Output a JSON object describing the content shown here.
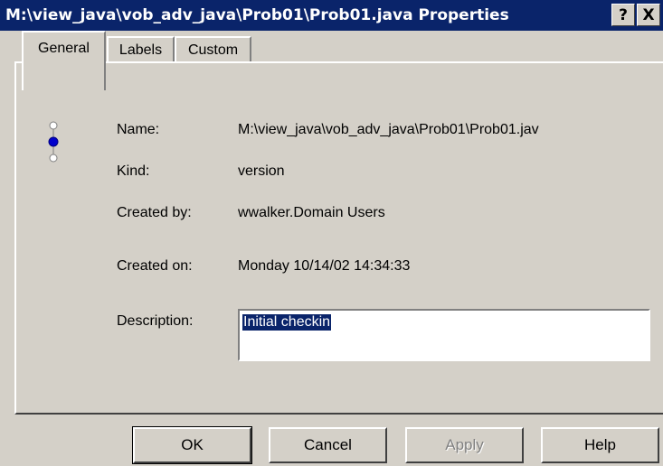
{
  "window": {
    "title": "M:\\view_java\\vob_adv_java\\Prob01\\Prob01.java Properties",
    "help_glyph": "?",
    "close_glyph": "X"
  },
  "tabs": [
    {
      "label": "General",
      "active": true
    },
    {
      "label": "Labels",
      "active": false
    },
    {
      "label": "Custom",
      "active": false
    }
  ],
  "icon": "version-tree-icon",
  "properties": {
    "name_label": "Name:",
    "name_value": "M:\\view_java\\vob_adv_java\\Prob01\\Prob01.jav",
    "kind_label": "Kind:",
    "kind_value": "version",
    "created_by_label": "Created by:",
    "created_by_value": "wwalker.Domain Users",
    "created_on_label": "Created on:",
    "created_on_value": "Monday 10/14/02 14:34:33",
    "description_label": "Description:",
    "description_value": "Initial checkin"
  },
  "buttons": {
    "ok": "OK",
    "cancel": "Cancel",
    "apply": "Apply",
    "help": "Help"
  },
  "colors": {
    "titlebar": "#0a246a",
    "face": "#d4d0c8",
    "selection": "#0a246a",
    "icon_node": "#0000cc"
  }
}
